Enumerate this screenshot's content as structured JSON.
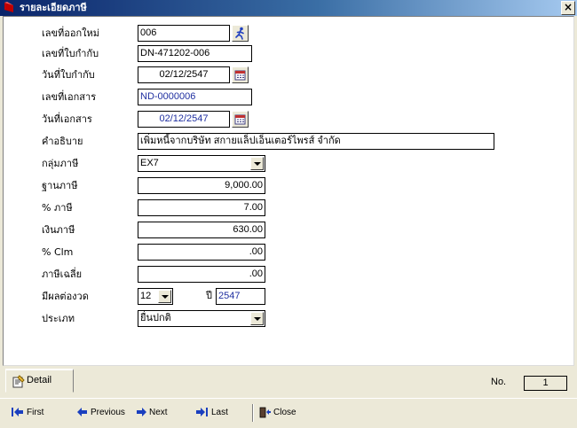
{
  "window": {
    "title": "รายละเอียดภาษี",
    "close_label": "×"
  },
  "form": {
    "fields": [
      {
        "label": "เลขที่ออกใหม่",
        "value": "006"
      },
      {
        "label": "เลขที่ใบกำกับ",
        "value": "DN-471202-006"
      },
      {
        "label": "วันที่ใบกำกับ",
        "value": "02/12/2547"
      },
      {
        "label": "เลขที่เอกสาร",
        "value": "ND-0000006"
      },
      {
        "label": "วันที่เอกสาร",
        "value": "02/12/2547"
      },
      {
        "label": "คำอธิบาย",
        "value": "เพิ่มหนี้จากบริษัท สกายแล็ปเอ็นเตอร์ไพรส์ จำกัด"
      },
      {
        "label": "กลุ่มภาษี",
        "value": "EX7"
      },
      {
        "label": "ฐานภาษี",
        "value": "9,000.00"
      },
      {
        "label": "% ภาษี",
        "value": "7.00"
      },
      {
        "label": "เงินภาษี",
        "value": "630.00"
      },
      {
        "label": "% Clm",
        "value": ".00"
      },
      {
        "label": "ภาษีเฉลี่ย",
        "value": ".00"
      },
      {
        "label": "มีผลต่องวด",
        "value": "12"
      },
      {
        "label": "ประเภท",
        "value": "ยื่นปกติ"
      }
    ],
    "year_label": "ปี",
    "year_value": "2547"
  },
  "tabs": [
    {
      "label": "Detail"
    }
  ],
  "record": {
    "no_label": "No.",
    "no_value": "1"
  },
  "navigation": {
    "first": "First",
    "previous": "Previous",
    "next": "Next",
    "last": "Last",
    "close": "Close"
  },
  "colors": {
    "titlebar_start": "#0a246a",
    "titlebar_end": "#a6caf0",
    "window_bg": "#ece9d8",
    "blue_text": "#1f2fa0",
    "nav_arrow": "#1a3fbf"
  }
}
